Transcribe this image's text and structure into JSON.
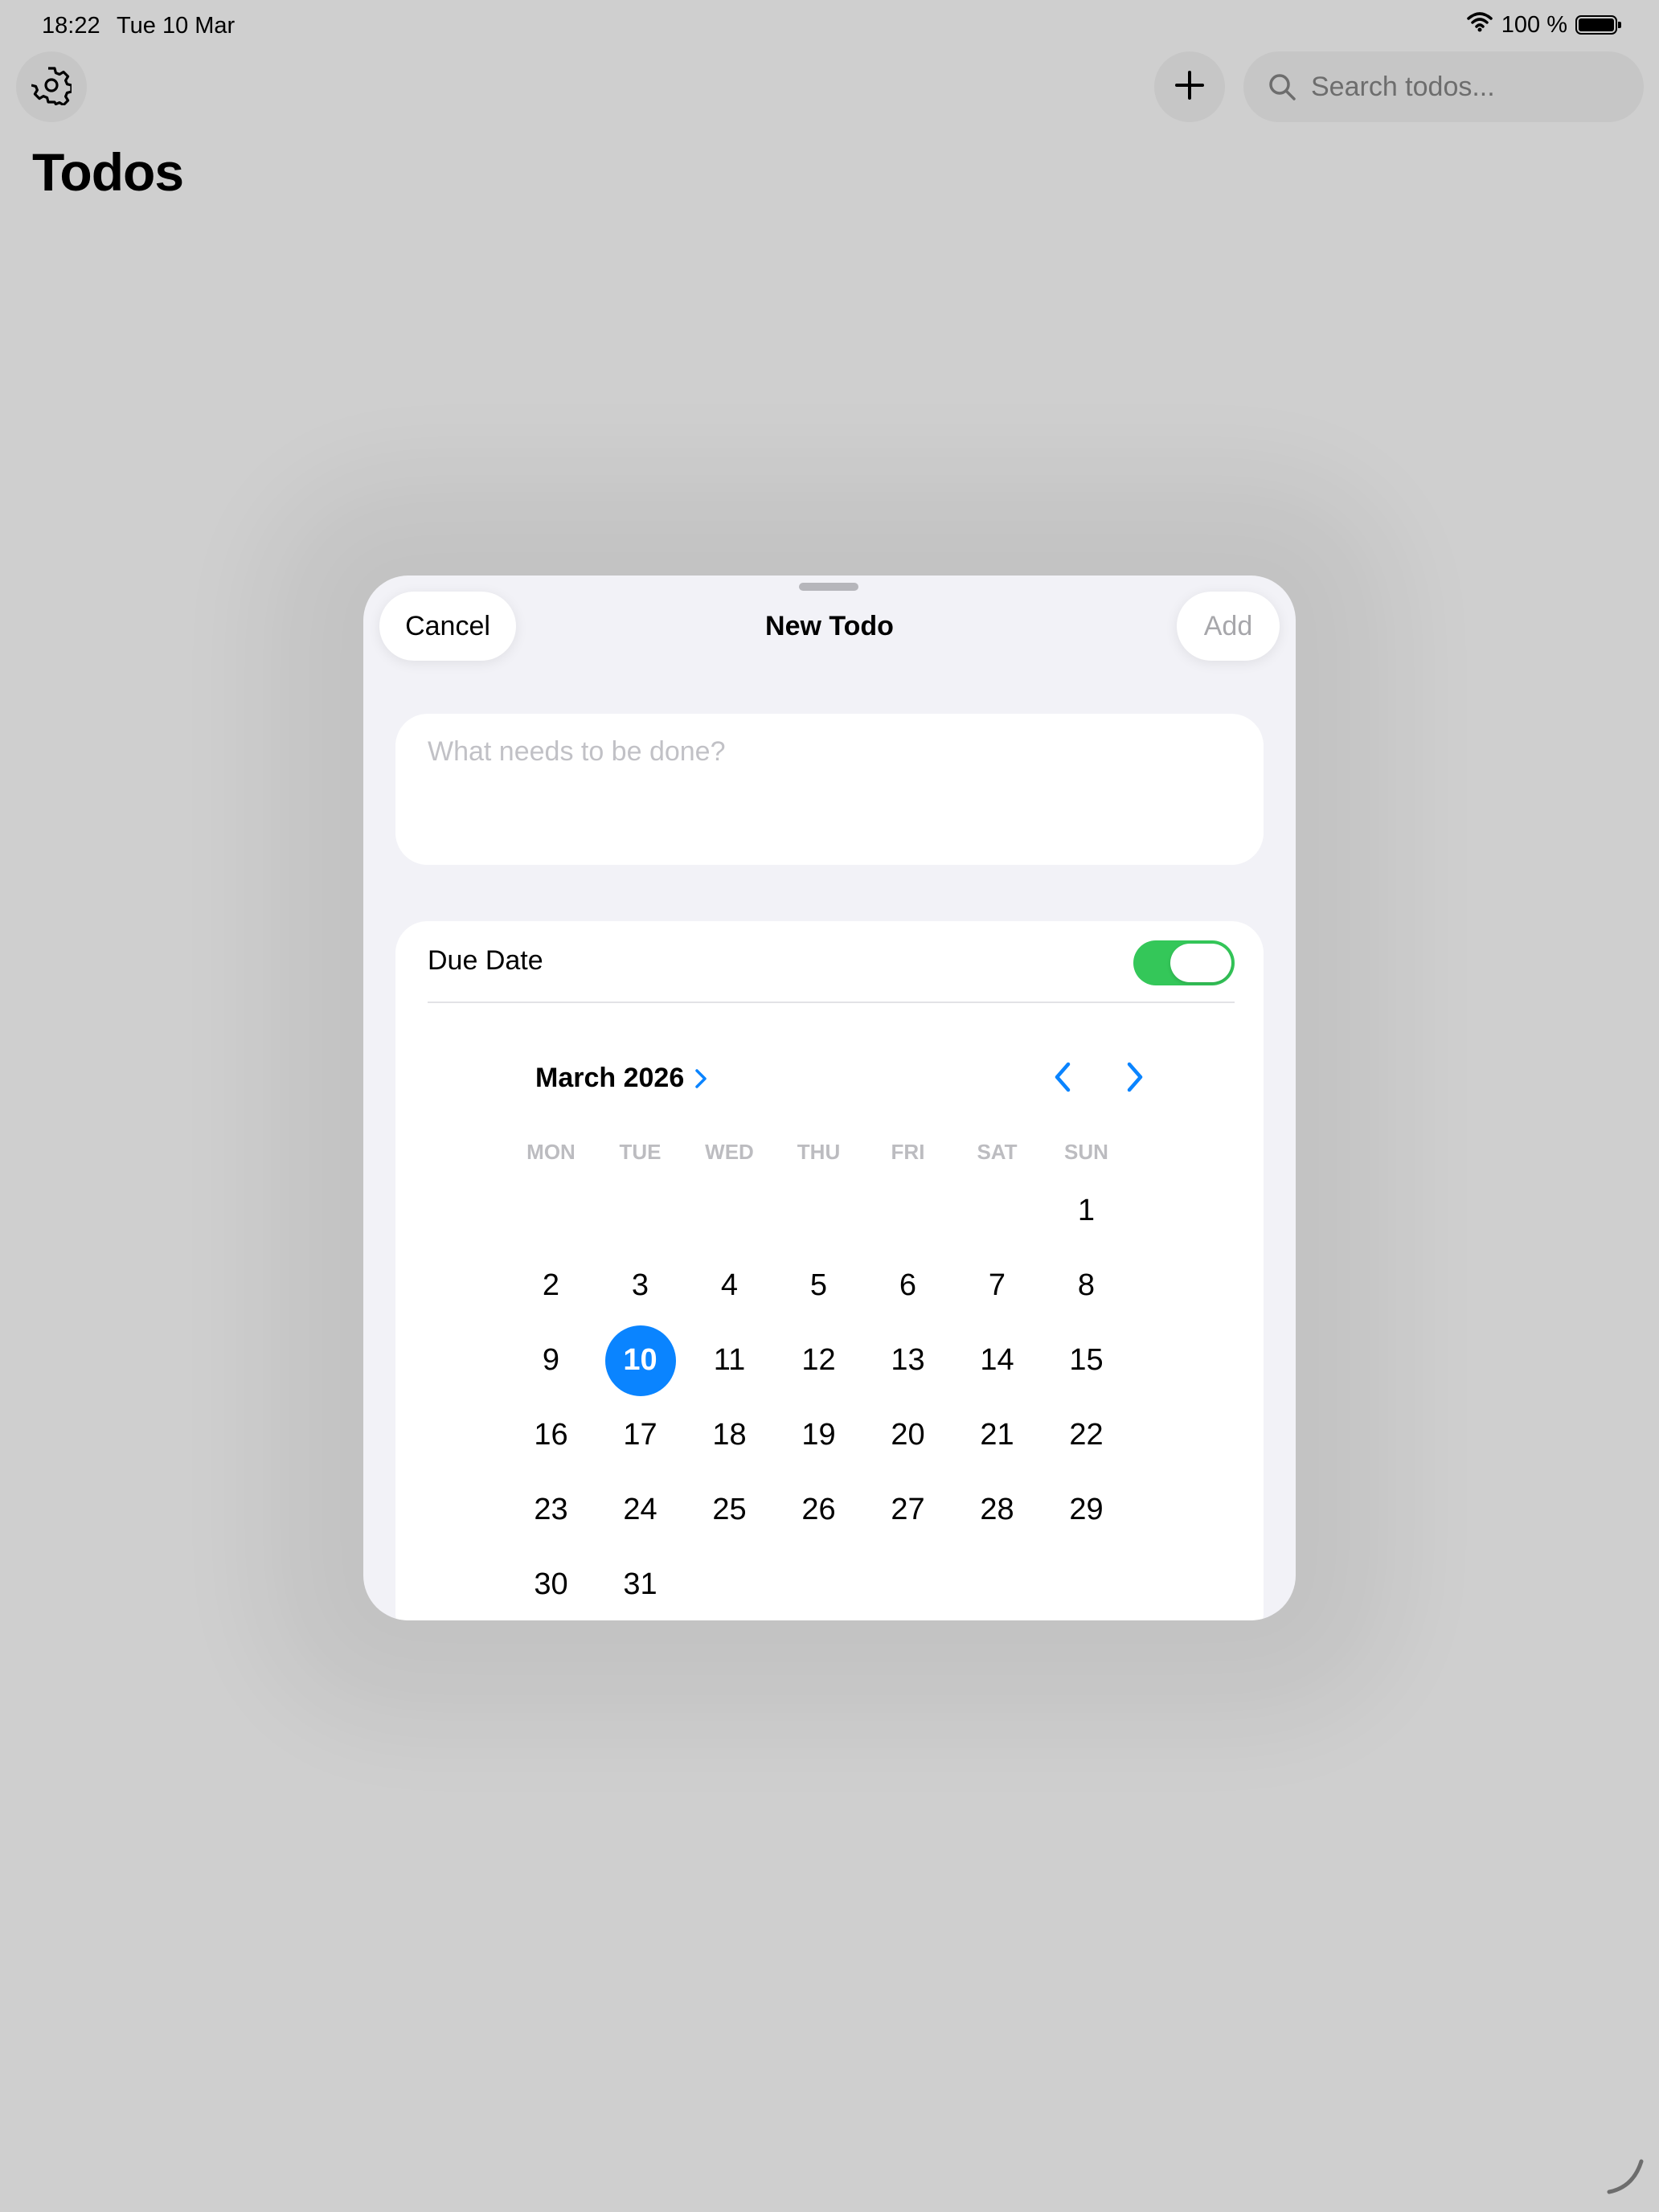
{
  "status_bar": {
    "time": "18:22",
    "date": "Tue 10 Mar",
    "battery": "100 %"
  },
  "toolbar": {
    "search_placeholder": "Search todos..."
  },
  "page": {
    "title": "Todos"
  },
  "sheet": {
    "title": "New Todo",
    "cancel_label": "Cancel",
    "add_label": "Add",
    "todo_placeholder": "What needs to be done?",
    "due_date_label": "Due Date",
    "due_date_enabled": true
  },
  "calendar": {
    "month_label": "March 2026",
    "weekdays": [
      "MON",
      "TUE",
      "WED",
      "THU",
      "FRI",
      "SAT",
      "SUN"
    ],
    "leading_blanks": 6,
    "days": [
      "1",
      "2",
      "3",
      "4",
      "5",
      "6",
      "7",
      "8",
      "9",
      "10",
      "11",
      "12",
      "13",
      "14",
      "15",
      "16",
      "17",
      "18",
      "19",
      "20",
      "21",
      "22",
      "23",
      "24",
      "25",
      "26",
      "27",
      "28",
      "29",
      "30",
      "31"
    ],
    "selected_day": "10"
  },
  "colors": {
    "accent": "#0a84ff",
    "toggle_on": "#34c759",
    "background": "#cfcfcf",
    "sheet_bg": "#f2f2f7"
  },
  "icons": [
    "gear-icon",
    "plus-icon",
    "search-icon",
    "wifi-icon",
    "battery-icon",
    "chevron-right-icon",
    "chevron-left-icon"
  ]
}
